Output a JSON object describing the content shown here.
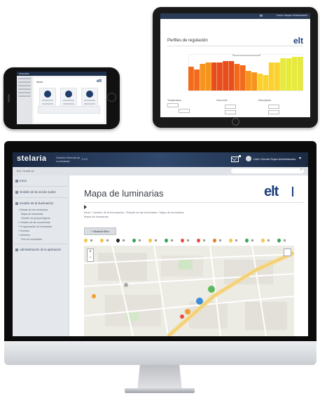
{
  "phone": {
    "brand": "STELARIA",
    "page_title": "Inicio",
    "logo": "elt"
  },
  "tablet": {
    "user": "Carlos Vaquer Administrador",
    "page_title": "Perfiles de regulación",
    "logo": "elt",
    "chart_colors": [
      "#f26b1d",
      "#f7941d",
      "#e84e1b",
      "#fbd12f",
      "#e6ea3c"
    ],
    "form": {
      "temperatura_label": "Temperatura",
      "hora_label": "Hora ciclo",
      "descripcion_label": "Descripción"
    }
  },
  "header": {
    "brand": "stelaria",
    "subtitle": "Gestión Remota de Luminarias",
    "version": "1.5.0",
    "user": "Lider Vicente Rojan Administrador",
    "mail_icon": "mail-icon",
    "chevron": "chevron-down-icon"
  },
  "crumb_bar": {
    "location": "ELT CLMS ue",
    "search_placeholder": ""
  },
  "sidebar": {
    "items": [
      {
        "label": "Inicio",
        "icon": "home-icon"
      },
      {
        "label": "Gestión de la red de nodos",
        "icon": "network-icon"
      },
      {
        "label": "Gestión de la iluminación",
        "icon": "chart-icon"
      }
    ],
    "subitems": [
      "» Estado de las luminarias",
      "Mapa de luminarias",
      "Gestión de grupos lógicos",
      "» Gestión de las ocurrencias",
      "» Programación de luminarias",
      "» Eventos",
      "» Informes",
      "Foto de luminarias"
    ],
    "footer_item": {
      "label": "Administración de la aplicación",
      "icon": "gear-icon"
    }
  },
  "main": {
    "title": "Mapa de luminarias",
    "logo": "elt",
    "breadcrumb": "Inicio / Gestión de la iluminación / Estado de las luminarias / Mapa de luminarias",
    "breadcrumb_current": "Mapa de luminarias",
    "toggle_button": "+ Mostrar filtro",
    "zoom_in": "+",
    "zoom_out": "−"
  },
  "map_marker_colors": [
    "#f4c542",
    "#f4c542",
    "#222222",
    "#2fa84f",
    "#f4c542",
    "#2fa84f",
    "#e74c3c",
    "#e74c3c",
    "#e67e22",
    "#f4c542",
    "#2fa84f",
    "#f4c542",
    "#2fa84f"
  ]
}
